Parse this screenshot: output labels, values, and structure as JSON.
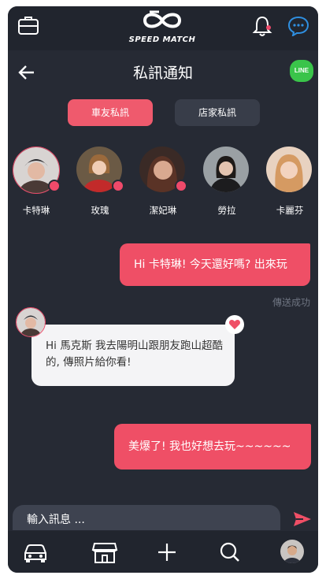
{
  "app": {
    "brand": "SPEED MATCH",
    "page_title": "私訊通知",
    "line_label": "LINE"
  },
  "tabs": [
    {
      "label": "車友私訊",
      "active": true
    },
    {
      "label": "店家私訊",
      "active": false
    }
  ],
  "contacts": [
    {
      "name": "卡特琳",
      "online": true
    },
    {
      "name": "玫瑰",
      "online": true
    },
    {
      "name": "潔妃琳",
      "online": true
    },
    {
      "name": "勞拉",
      "online": false
    },
    {
      "name": "卡麗芬",
      "online": false
    }
  ],
  "messages": [
    {
      "direction": "out",
      "text": "Hi 卡特琳! 今天還好嗎? 出來玩"
    },
    {
      "direction": "status",
      "text": "傳送成功"
    },
    {
      "direction": "in",
      "text": "Hi 馬克斯 我去陽明山跟朋友跑山超酷的, 傳照片給你看!"
    },
    {
      "direction": "out",
      "text": "美爆了! 我也好想去玩~~~~~~"
    }
  ],
  "composer": {
    "placeholder": "輸入訊息 ..."
  },
  "colors": {
    "accent": "#ef4f66",
    "background": "#262a34",
    "bar": "#21252e",
    "line": "#3ac44a"
  },
  "icons": [
    "briefcase-icon",
    "speed-match-logo",
    "bell-icon",
    "chat-icon",
    "back-arrow-icon",
    "line-icon",
    "heart-icon",
    "send-icon",
    "car-icon",
    "store-icon",
    "plus-icon",
    "search-icon",
    "profile-avatar"
  ]
}
